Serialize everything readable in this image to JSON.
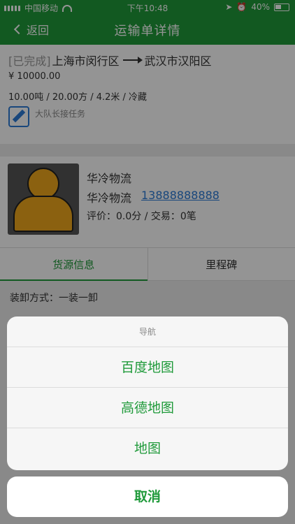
{
  "status_bar": {
    "carrier": "中国移动",
    "time": "下午10:48",
    "battery": "40%"
  },
  "nav": {
    "back_label": "返回",
    "title": "运输单详情"
  },
  "order": {
    "status": "[已完成]",
    "from": "上海市闵行区",
    "to": "武汉市汉阳区",
    "price": "¥ 10000.00",
    "spec": "10.00吨 / 20.00方 / 4.2米 / 冷藏",
    "task_note": "大队长接任务"
  },
  "carrier": {
    "name": "华冷物流",
    "company": "华冷物流",
    "phone": "13888888888",
    "rating": "评价：0.0分 / 交易：0笔"
  },
  "tabs": [
    {
      "label": "货源信息"
    },
    {
      "label": "里程碑"
    }
  ],
  "detail": {
    "loading": "装卸方式：一装一卸"
  },
  "action_sheet": {
    "title": "导航",
    "options": [
      {
        "label": "百度地图"
      },
      {
        "label": "高德地图"
      },
      {
        "label": "地图"
      }
    ],
    "cancel": "取消"
  },
  "colors": {
    "primary": "#1f9a3a",
    "link": "#2b7bd6"
  }
}
